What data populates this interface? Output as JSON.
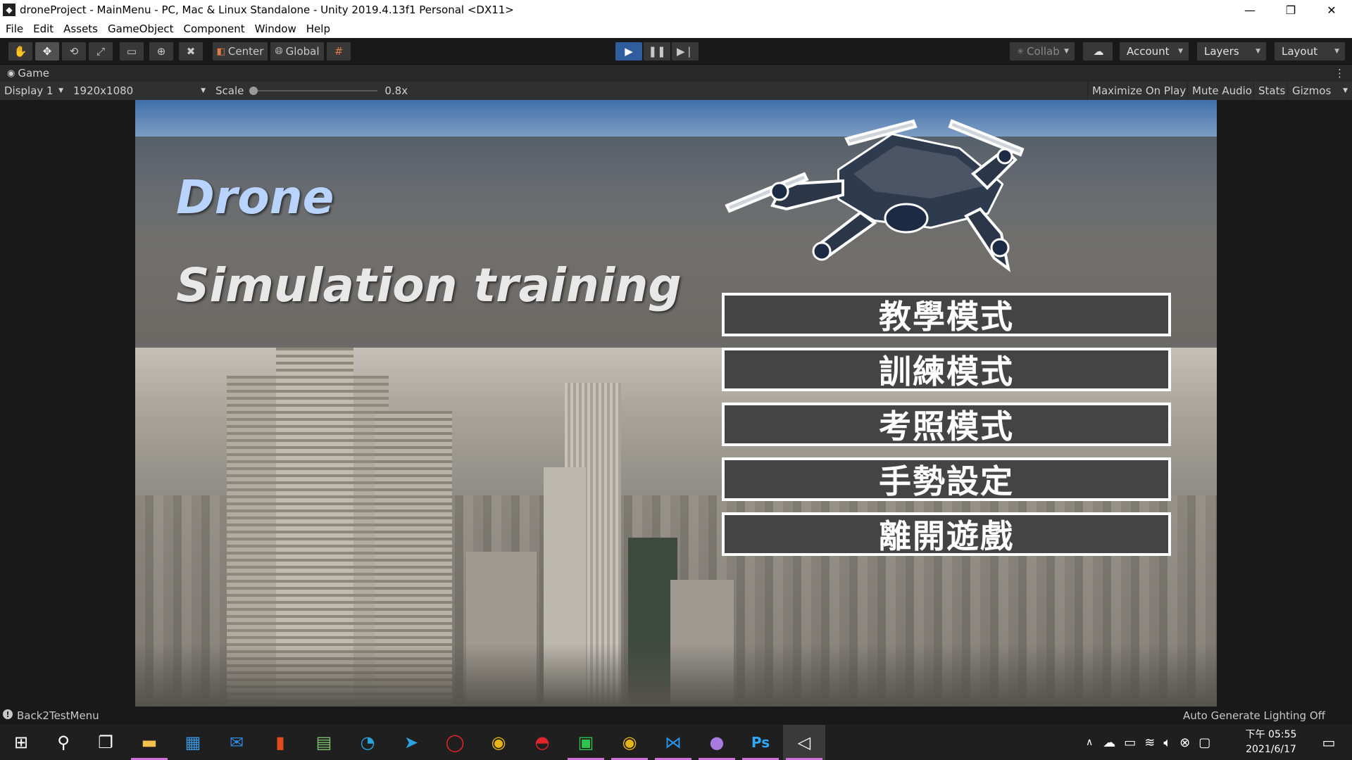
{
  "window": {
    "title": "droneProject - MainMenu - PC, Mac & Linux Standalone - Unity 2019.4.13f1 Personal <DX11>",
    "controls": [
      "—",
      "❐",
      "✕"
    ]
  },
  "menu": [
    "File",
    "Edit",
    "Assets",
    "GameObject",
    "Component",
    "Window",
    "Help"
  ],
  "toolbar": {
    "pivot": "Center",
    "space": "Global",
    "collab": "Collab",
    "account": "Account",
    "layers": "Layers",
    "layout": "Layout"
  },
  "game_panel": {
    "tab": "Game",
    "display": "Display 1",
    "resolution": "1920x1080",
    "scale_label": "Scale",
    "scale_value": "0.8x",
    "maximize_on_play": "Maximize On Play",
    "mute_audio": "Mute Audio",
    "stats": "Stats",
    "gizmos": "Gizmos"
  },
  "game": {
    "title_line1": "Drone",
    "title_line2": "Simulation training",
    "buttons": [
      "教學模式",
      "訓練模式",
      "考照模式",
      "手勢設定",
      "離開遊戲"
    ]
  },
  "status": {
    "left": "Back2TestMenu",
    "right": "Auto Generate Lighting Off"
  },
  "taskbar": {
    "icons": [
      "windows-start-icon",
      "search-icon",
      "task-view-icon",
      "file-explorer-icon",
      "store-icon",
      "mail-icon",
      "office-icon",
      "notepad-icon",
      "edge-icon",
      "telegram-icon",
      "opera-icon",
      "chrome-icon",
      "garena-icon",
      "line-icon",
      "chrome-alt-icon",
      "vscode-icon",
      "github-icon",
      "photoshop-icon",
      "unity-icon"
    ],
    "time": "下午 05:55",
    "date": "2021/6/17"
  },
  "colors": {
    "unity_dark": "#191919",
    "play_active": "#2f5d9e",
    "menu_button_bg": "#444444",
    "drone_title": "#b9d3ff"
  }
}
